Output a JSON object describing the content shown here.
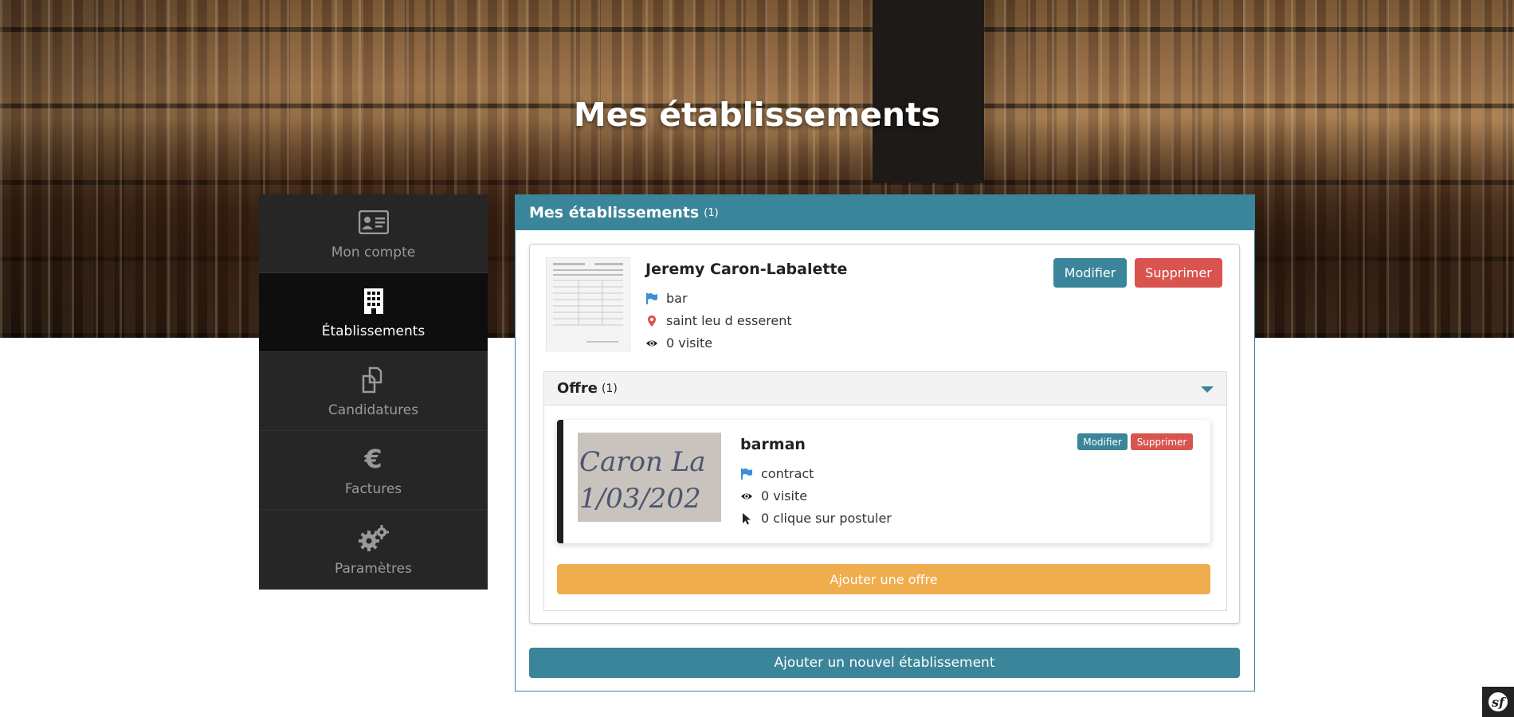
{
  "hero": {
    "title": "Mes établissements"
  },
  "sidebar": {
    "items": [
      {
        "label": "Mon compte",
        "icon": "id-card-icon",
        "active": false
      },
      {
        "label": "Établissements",
        "icon": "building-icon",
        "active": true
      },
      {
        "label": "Candidatures",
        "icon": "copy-icon",
        "active": false
      },
      {
        "label": "Factures",
        "icon": "euro-icon",
        "active": false
      },
      {
        "label": "Paramètres",
        "icon": "gears-icon",
        "active": false
      }
    ]
  },
  "panel": {
    "title": "Mes établissements",
    "count": "(1)",
    "establishment": {
      "name": "Jeremy Caron-Labalette",
      "type": "bar",
      "city": "saint leu d esserent",
      "visits": "0 visite",
      "edit_label": "Modifier",
      "delete_label": "Supprimer",
      "offers_section": {
        "title": "Offre",
        "count": "(1)",
        "offer": {
          "title": "barman",
          "contract": "contract",
          "visits": "0 visite",
          "clicks": "0 clique sur postuler",
          "edit_label": "Modifier",
          "delete_label": "Supprimer",
          "image_text_line1": "Caron La",
          "image_text_line2": "1/03/202"
        },
        "add_offer_label": "Ajouter une offre"
      }
    },
    "add_establishment_label": "Ajouter un nouvel établissement"
  },
  "colors": {
    "teal": "#3a8599",
    "red": "#d9534f",
    "orange": "#f0ad4e",
    "sidebar_bg": "#262626",
    "sidebar_active": "#0e0e0e"
  }
}
